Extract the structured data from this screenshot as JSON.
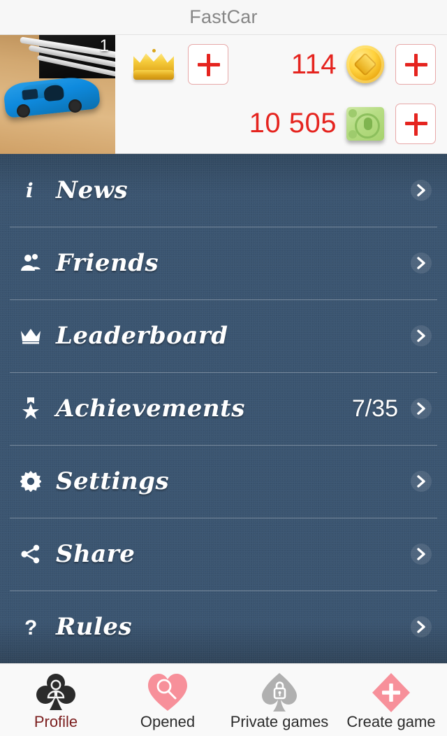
{
  "header": {
    "title": "FastCar"
  },
  "profile": {
    "avatar_name": "user-avatar-photo",
    "avatar_description": "blue toy car on wooden desk",
    "level_badge": "1"
  },
  "currency": {
    "crown": {
      "icon": "crown-icon",
      "add_label": "+"
    },
    "coins": {
      "value": "114",
      "icon": "coin-icon",
      "add_label": "+"
    },
    "money": {
      "value": "10 505",
      "icon": "banknote-icon",
      "add_label": "+"
    }
  },
  "menu": {
    "items": [
      {
        "id": "news",
        "label": "News",
        "icon": "info-icon",
        "badge": ""
      },
      {
        "id": "friends",
        "label": "Friends",
        "icon": "users-icon",
        "badge": ""
      },
      {
        "id": "leaderboard",
        "label": "Leaderboard",
        "icon": "crown-icon",
        "badge": ""
      },
      {
        "id": "achievements",
        "label": "Achievements",
        "icon": "award-star-icon",
        "badge": "7/35"
      },
      {
        "id": "settings",
        "label": "Settings",
        "icon": "gear-icon",
        "badge": ""
      },
      {
        "id": "share",
        "label": "Share",
        "icon": "share-nodes-icon",
        "badge": ""
      },
      {
        "id": "rules",
        "label": "Rules",
        "icon": "question-icon",
        "badge": ""
      }
    ],
    "arrow_icon": "chevron-right-icon"
  },
  "tabbar": {
    "tabs": [
      {
        "id": "profile",
        "label": "Profile",
        "icon": "club-person-icon",
        "active": true
      },
      {
        "id": "opened",
        "label": "Opened",
        "icon": "heart-search-icon",
        "active": false
      },
      {
        "id": "private-games",
        "label": "Private games",
        "icon": "spade-lock-icon",
        "active": false
      },
      {
        "id": "create-game",
        "label": "Create game",
        "icon": "diamond-plus-icon",
        "active": false
      }
    ]
  },
  "colors": {
    "panel_blue": "#37506b",
    "accent_red": "#e5241f",
    "pink": "#f7909a",
    "gray_icon": "#b0b0b0",
    "dark_icon": "#2b2b2b",
    "active_label": "#7b1e1e",
    "title_gray": "#868686"
  }
}
